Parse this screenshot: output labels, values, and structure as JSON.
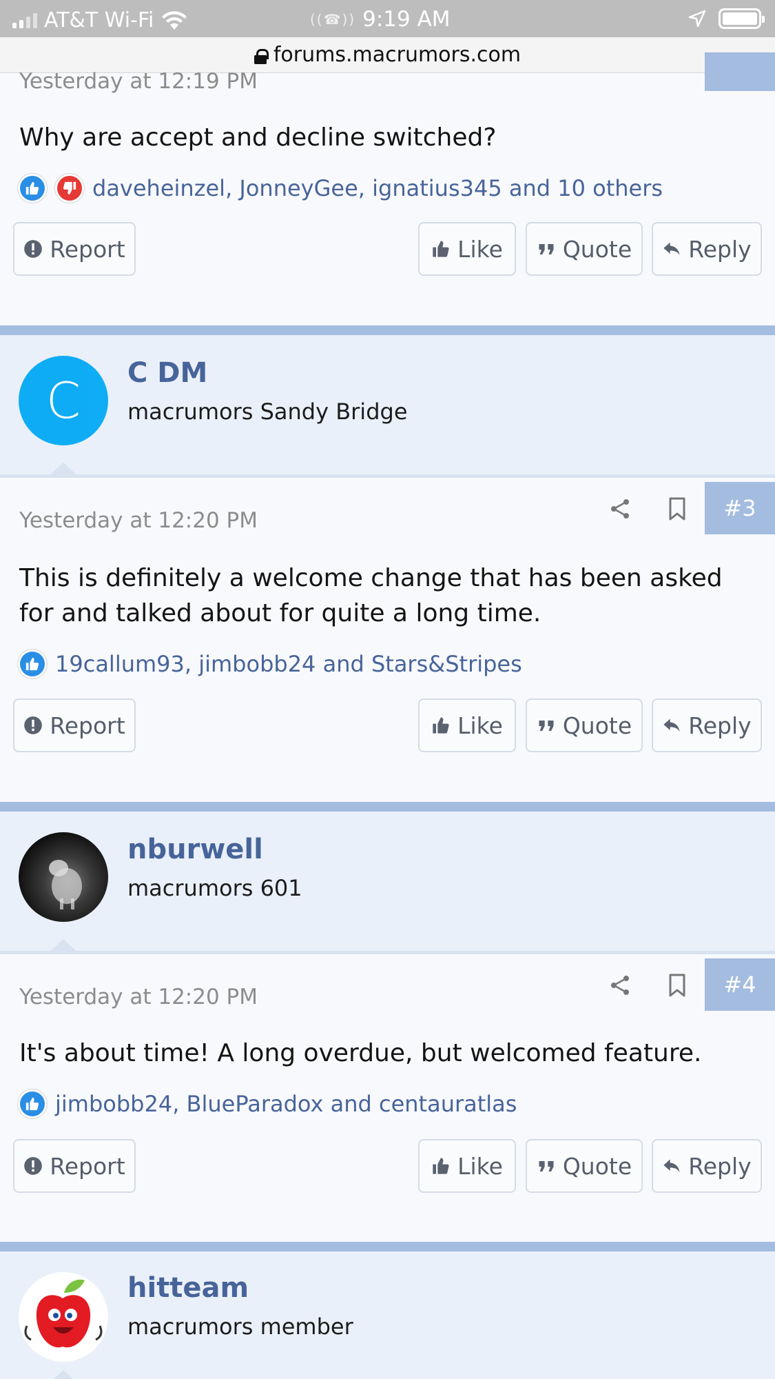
{
  "status_bar": {
    "carrier": "AT&T Wi-Fi",
    "time": "9:19 AM"
  },
  "url_bar": {
    "domain": "forums.macrumors.com"
  },
  "buttons": {
    "report": "Report",
    "like": "Like",
    "quote": "Quote",
    "reply": "Reply"
  },
  "posts": [
    {
      "date": "Yesterday at 12:19 PM",
      "text": "Why are accept and decline switched?",
      "reactions": "daveheinzel, JonneyGee, ignatius345 and 10 others",
      "reaction_icons": [
        "like-icon",
        "dislike-icon"
      ]
    },
    {
      "user": {
        "name": "C DM",
        "title": "macrumors Sandy Bridge",
        "avatar_letter": "C",
        "avatar_color": "#03a9f4"
      },
      "date": "Yesterday at 12:20 PM",
      "number": "#3",
      "text": "This is definitely a welcome change that has been asked for and talked about for quite a long time.",
      "reactions": "19callum93, jimbobb24 and Stars&Stripes",
      "reaction_icons": [
        "like-icon"
      ]
    },
    {
      "user": {
        "name": "nburwell",
        "title": "macrumors 601"
      },
      "date": "Yesterday at 12:20 PM",
      "number": "#4",
      "text": "It's about time! A long overdue, but welcomed feature.",
      "reactions": "jimbobb24, BlueParadox and centauratlas",
      "reaction_icons": [
        "like-icon"
      ]
    },
    {
      "user": {
        "name": "hitteam",
        "title": "macrumors member"
      }
    }
  ],
  "colors": {
    "accent": "#a3bcdf",
    "username": "#47649a",
    "user_block_bg": "#eaf0f9"
  }
}
